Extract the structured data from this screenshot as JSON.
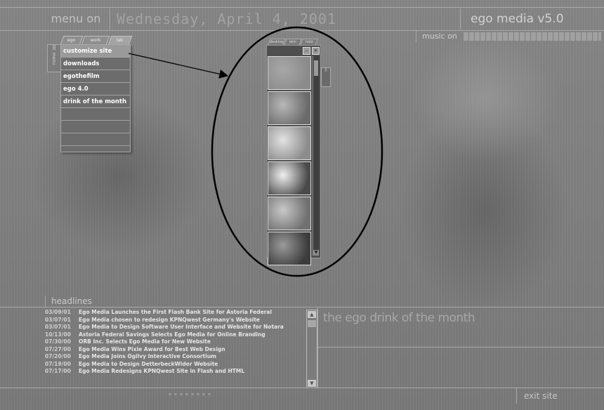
{
  "header": {
    "menu_label": "menu on",
    "date": "Wednesday, April 4, 2001",
    "brand": "ego media v5.0",
    "music_label": "music on"
  },
  "menu": {
    "tabs": [
      "ego",
      "work",
      "lab"
    ],
    "active_tab": "lab",
    "side_label": "menu",
    "items": [
      "customize site",
      "downloads",
      "egothefilm",
      "ego 4.0",
      "drink of the month",
      "",
      "",
      ""
    ],
    "selected": "customize site"
  },
  "viewer": {
    "tabs": [
      "desktop",
      "skin",
      "hold"
    ],
    "thumbnails": [
      {
        "name": "thumb-blank",
        "colors": [
          "#a7a7a7",
          "#8b8b8b"
        ]
      },
      {
        "name": "thumb-circles",
        "colors": [
          "#b8b8b8",
          "#6a6a6a"
        ]
      },
      {
        "name": "thumb-dots",
        "colors": [
          "#e2e2e2",
          "#8c8c8c"
        ]
      },
      {
        "name": "thumb-curve",
        "colors": [
          "#f0f0f0",
          "#4a4a4a"
        ]
      },
      {
        "name": "thumb-figure",
        "colors": [
          "#c8c8c8",
          "#707070"
        ]
      },
      {
        "name": "thumb-dark",
        "colors": [
          "#9a9a9a",
          "#3c3c3c"
        ]
      }
    ]
  },
  "headlines": {
    "label": "headlines",
    "items": [
      {
        "date": "03/09/01",
        "text": "Ego Media Launches the First Flash Bank Site for Astoria Federal"
      },
      {
        "date": "03/07/01",
        "text": "Ego Media chosen to redesign KPNQwest Germany's Website"
      },
      {
        "date": "03/07/01",
        "text": "Ego Media to Design Software User Interface and Website for Notara"
      },
      {
        "date": "10/13/00",
        "text": "Astoria Federal Savings Selects Ego Media for Online Branding"
      },
      {
        "date": "07/30/00",
        "text": "ORB Inc. Selects Ego Media for New Website"
      },
      {
        "date": "07/27/00",
        "text": "Ego Media Wins Pixie Award for Best Web Design"
      },
      {
        "date": "07/20/00",
        "text": "Ego Media Joins Ogilvy Interactive Consortium"
      },
      {
        "date": "07/19/00",
        "text": "Ego Media to Design DetterbeckWider Website"
      },
      {
        "date": "07/17/00",
        "text": "Ego Media Redesigns KPNQwest Site in Flash and HTML"
      }
    ]
  },
  "drink": {
    "title": "the ego drink of the month"
  },
  "footer": {
    "exit_label": "exit site"
  }
}
